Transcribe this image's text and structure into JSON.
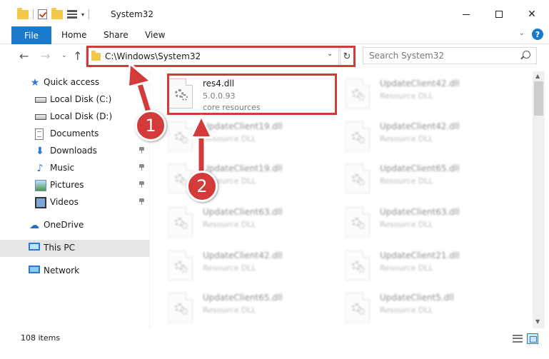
{
  "window": {
    "title": "System32",
    "quick_access_dropdown": "▾",
    "minimize": "",
    "maximize": "",
    "close": "✕"
  },
  "ribbon": {
    "file": "File",
    "home": "Home",
    "share": "Share",
    "view": "View",
    "toggle": "⌄",
    "help": "?"
  },
  "nav": {
    "back": "←",
    "forward": "→",
    "recent": "⌄",
    "up": "↑",
    "address": "C:\\Windows\\System32",
    "address_dropdown": "⌄",
    "refresh": "↻",
    "search_placeholder": "Search System32"
  },
  "sidebar": {
    "items": [
      {
        "label": "Quick access",
        "icon": "star-icon"
      },
      {
        "label": "Local Disk (C:)",
        "icon": "drive-icon"
      },
      {
        "label": "Local Disk (D:)",
        "icon": "drive-icon"
      },
      {
        "label": "Documents",
        "icon": "documents-icon",
        "pinned": true
      },
      {
        "label": "Downloads",
        "icon": "downloads-icon",
        "pinned": true
      },
      {
        "label": "Music",
        "icon": "music-icon",
        "pinned": true
      },
      {
        "label": "Pictures",
        "icon": "pictures-icon",
        "pinned": true
      },
      {
        "label": "Videos",
        "icon": "videos-icon",
        "pinned": true
      },
      {
        "label": "OneDrive",
        "icon": "onedrive-icon"
      },
      {
        "label": "This PC",
        "icon": "this-pc-icon",
        "selected": true
      },
      {
        "label": "Network",
        "icon": "network-icon"
      }
    ]
  },
  "files": [
    {
      "name": "res4.dll",
      "line2": "5.0.0.93",
      "line3": "core resources",
      "highlighted": true
    },
    {
      "name": "UpdateClient42.dll",
      "line2": "Resource DLL",
      "line3": ""
    },
    {
      "name": "UpdateClient19.dll",
      "line2": "Resource DLL",
      "line3": ""
    },
    {
      "name": "UpdateClient42.dll",
      "line2": "Resource DLL",
      "line3": ""
    },
    {
      "name": "UpdateClient19.dll",
      "line2": "Resource DLL",
      "line3": ""
    },
    {
      "name": "UpdateClient65.dll",
      "line2": "Resource DLL",
      "line3": ""
    },
    {
      "name": "UpdateClient63.dll",
      "line2": "Resource DLL",
      "line3": ""
    },
    {
      "name": "UpdateClient63.dll",
      "line2": "Resource DLL",
      "line3": ""
    },
    {
      "name": "UpdateClient42.dll",
      "line2": "Resource DLL",
      "line3": ""
    },
    {
      "name": "UpdateClient21.dll",
      "line2": "Resource DLL",
      "line3": ""
    },
    {
      "name": "UpdateClient65.dll",
      "line2": "Resource DLL",
      "line3": ""
    },
    {
      "name": "UpdateClient5.dll",
      "line2": "Resource DLL",
      "line3": ""
    }
  ],
  "status": {
    "count": "108 items"
  },
  "annotations": {
    "step1": "1",
    "step2": "2",
    "color": "#d33a3a"
  },
  "colors": {
    "accent": "#1979ca",
    "highlight": "#d33a3a",
    "selected_bg": "#e5e5e5"
  }
}
